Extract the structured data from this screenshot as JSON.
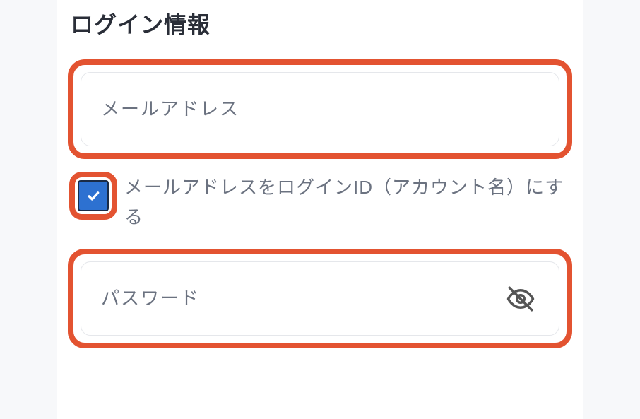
{
  "section": {
    "title": "ログイン情報"
  },
  "fields": {
    "email": {
      "placeholder": "メールアドレス",
      "value": ""
    },
    "password": {
      "placeholder": "パスワード",
      "value": ""
    }
  },
  "checkbox": {
    "label": "メールアドレスをログインID（アカウント名）にする",
    "checked": true
  }
}
